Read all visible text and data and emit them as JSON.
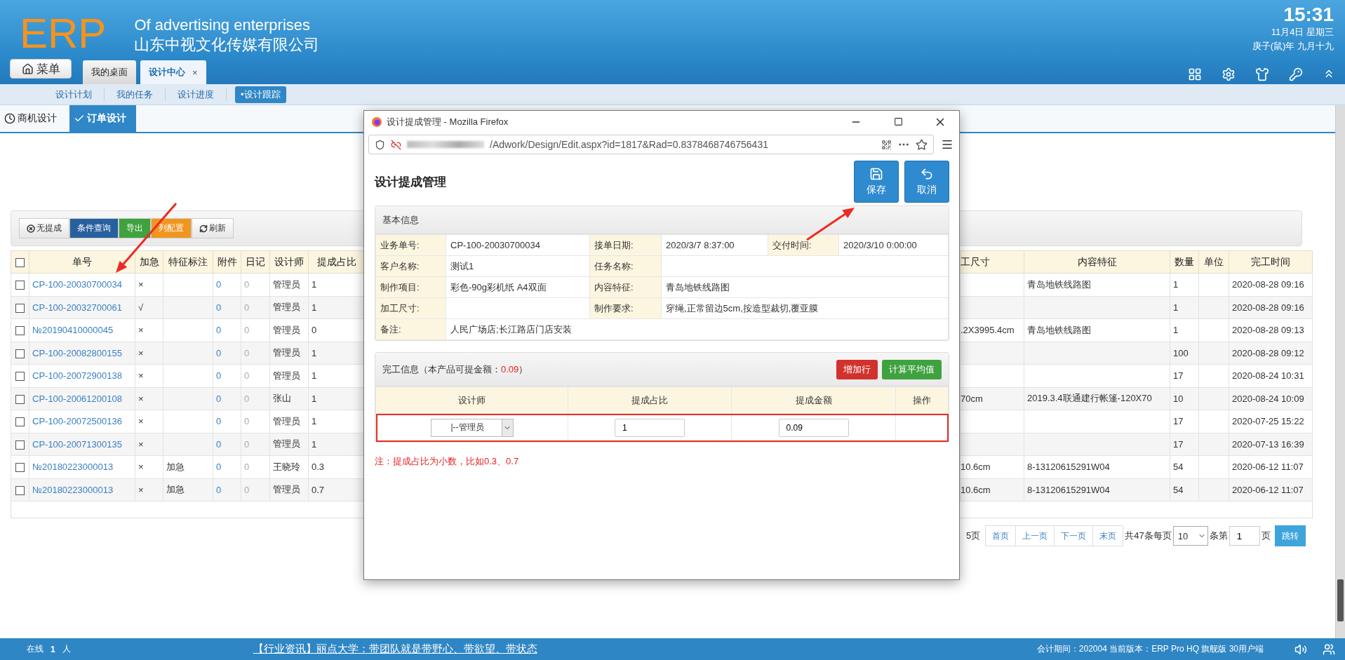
{
  "header": {
    "logo": "ERP",
    "title": "Of advertising enterprises",
    "company": "山东中视文化传媒有限公司",
    "clock": {
      "time": "15:31",
      "date": "11月4日 星期三",
      "lunar": "庚子(鼠)年 九月十九"
    }
  },
  "menu_button": "菜单",
  "tabs": [
    {
      "label": "我的桌面",
      "selected": false
    },
    {
      "label": "设计中心",
      "selected": true,
      "close": "×"
    }
  ],
  "subnav": [
    {
      "label": "设计计划",
      "selected": false
    },
    {
      "label": "我的任务",
      "selected": false
    },
    {
      "label": "设计进度",
      "selected": false
    },
    {
      "label": "•设计跟踪",
      "selected": true
    }
  ],
  "module_tabs": [
    {
      "label": "商机设计",
      "selected": false
    },
    {
      "label": "订单设计",
      "selected": true
    }
  ],
  "toolbar": [
    {
      "label": "无提成",
      "kind": "plain"
    },
    {
      "label": "条件查询",
      "kind": "primary"
    },
    {
      "label": "导出",
      "kind": "success"
    },
    {
      "label": "列配置",
      "kind": "warning"
    },
    {
      "label": "刷新",
      "kind": "plain"
    }
  ],
  "table": {
    "all_checked": false,
    "columns": [
      {
        "label": "单号",
        "kind": "link"
      },
      {
        "label": "加急",
        "kind": "text"
      },
      {
        "label": "特征标注",
        "kind": "text"
      },
      {
        "label": "附件",
        "kind": "count"
      },
      {
        "label": "日记",
        "kind": "muted"
      },
      {
        "label": "设计师",
        "kind": "text"
      },
      {
        "label": "提成占比",
        "kind": "text"
      },
      {
        "label": "工尺寸",
        "kind": "text"
      },
      {
        "label": "内容特征",
        "kind": "text"
      },
      {
        "label": "数量",
        "kind": "text"
      },
      {
        "label": "单位",
        "kind": "text"
      },
      {
        "label": "完工时间",
        "kind": "text"
      }
    ],
    "rows": [
      {
        "checked": false,
        "cells": [
          "CP-100-20030700034",
          "×",
          "",
          "0",
          "0",
          "管理员",
          "1",
          "",
          "青岛地铁线路图",
          "1",
          "",
          "2020-08-28 09:16"
        ]
      },
      {
        "checked": false,
        "cells": [
          "CP-100-20032700061",
          "√",
          "",
          "0",
          "0",
          "管理员",
          "1",
          "",
          "",
          "1",
          "",
          "2020-08-28 09:16"
        ]
      },
      {
        "checked": false,
        "cells": [
          "№20190410000045",
          "×",
          "",
          "0",
          "0",
          "管理员",
          "0",
          ".2X3995.4cm",
          "青岛地铁线路图",
          "1",
          "",
          "2020-08-28 09:13"
        ]
      },
      {
        "checked": false,
        "cells": [
          "CP-100-20082800155",
          "×",
          "",
          "0",
          "0",
          "管理员",
          "1",
          "",
          "",
          "100",
          "",
          "2020-08-28 09:12"
        ]
      },
      {
        "checked": false,
        "cells": [
          "CP-100-20072900138",
          "×",
          "",
          "0",
          "0",
          "管理员",
          "1",
          "",
          "",
          "17",
          "",
          "2020-08-24 10:31"
        ]
      },
      {
        "checked": false,
        "cells": [
          "CP-100-20061200108",
          "×",
          "",
          "0",
          "0",
          "张山",
          "1",
          "70cm",
          "2019.3.4联通建行帐篷-120X70",
          "10",
          "",
          "2020-08-24 10:09"
        ]
      },
      {
        "checked": false,
        "cells": [
          "CP-100-20072500136",
          "×",
          "",
          "0",
          "0",
          "管理员",
          "1",
          "",
          "",
          "17",
          "",
          "2020-07-25 15:22"
        ]
      },
      {
        "checked": false,
        "cells": [
          "CP-100-20071300135",
          "×",
          "",
          "0",
          "0",
          "管理员",
          "1",
          "",
          "",
          "17",
          "",
          "2020-07-13 16:39"
        ]
      },
      {
        "checked": false,
        "cells": [
          "№20180223000013",
          "×",
          "加急",
          "0",
          "0",
          "王晓玲",
          "0.3",
          "10.6cm",
          "8-13120615291W04",
          "54",
          "",
          "2020-06-12 11:07"
        ]
      },
      {
        "checked": false,
        "cells": [
          "№20180223000013",
          "×",
          "加急",
          "0",
          "0",
          "管理员",
          "0.7",
          "10.6cm",
          "8-13120615291W04",
          "54",
          "",
          "2020-06-12 11:07"
        ]
      }
    ]
  },
  "pagination": {
    "pages": "5页",
    "buttons": [
      "首页",
      "上一页",
      "下一页",
      "末页"
    ],
    "total": "共47条每页",
    "page_size": "10",
    "page_label": "条第",
    "page": "1",
    "page_suffix": "页",
    "go": "跳转"
  },
  "status_bar": {
    "online_label": "在线",
    "online_count": "1",
    "online_unit": "人",
    "news": "【行业资讯】丽点大学：带团队就是带野心、带欲望、带状态",
    "info": "会计期间：202004 当前版本：ERP Pro HQ 旗舰版 30用户端"
  },
  "popup": {
    "window_title": "设计提成管理 - Mozilla Firefox",
    "url": "/Adwork/Design/Edit.aspx?id=1817&Rad=0.8378468746756431",
    "heading": "设计提成管理",
    "actions": [
      {
        "label": "保存"
      },
      {
        "label": "取消"
      }
    ],
    "basic": {
      "title": "基本信息",
      "rows": [
        [
          {
            "label": "业务单号:",
            "value": "CP-100-20030700034"
          },
          {
            "label": "接单日期:",
            "value": "2020/3/7 8:37:00"
          },
          {
            "label": "交付时间:",
            "value": "2020/3/10 0:00:00"
          }
        ],
        [
          {
            "label": "客户名称:",
            "value": "测试1"
          },
          {
            "label": "任务名称:"
          }
        ],
        [
          {
            "label": "制作项目:",
            "value": "彩色-90g彩机纸 A4双面"
          },
          {
            "label": "内容特征:",
            "value": "青岛地铁线路图"
          }
        ],
        [
          {
            "label": "加工尺寸:"
          },
          {
            "label": "制作要求:",
            "value": "穿绳,正常留边5cm,按造型裁切,覆亚膜"
          }
        ],
        [
          {
            "label": "备注:",
            "value": "人民广场店;长江路店门店安装"
          }
        ]
      ]
    },
    "completion": {
      "title": "完工信息（本产品可提金额：",
      "amount": "0.09",
      "title_end": "）",
      "buttons": [
        {
          "label": "增加行",
          "kind": "danger"
        },
        {
          "label": "计算平均值",
          "kind": "success"
        }
      ],
      "columns": [
        "设计师",
        "提成占比",
        "提成金额",
        "操作"
      ],
      "rows": [
        {
          "designer": "|--管理员",
          "ratio": "1",
          "amount": "0.09"
        }
      ]
    },
    "note": "注：提成占比为小数，比如0.3、0.7"
  }
}
